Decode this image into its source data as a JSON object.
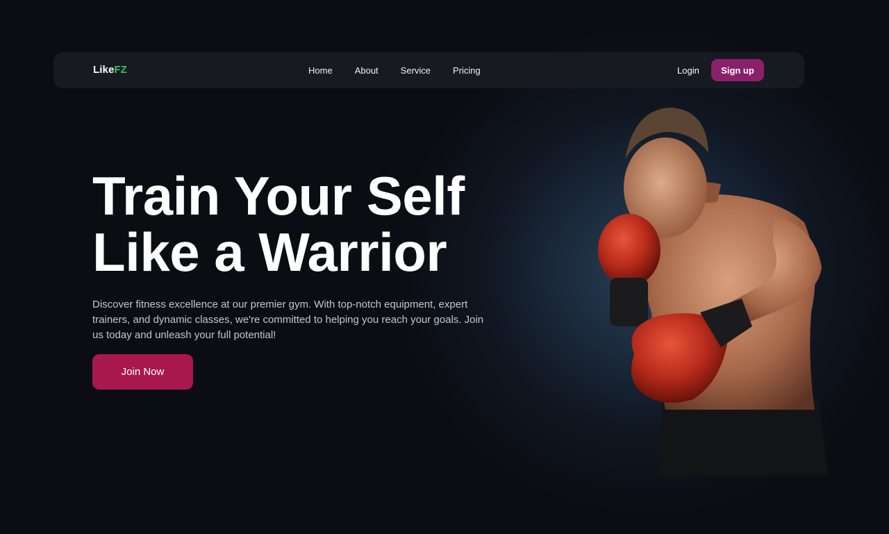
{
  "brand": {
    "logo_white": "Like",
    "logo_green": "FZ",
    "accent_green": "#3fbf5a"
  },
  "nav": {
    "links": [
      "Home",
      "About",
      "Service",
      "Pricing"
    ],
    "login_label": "Login",
    "signup_label": "Sign up",
    "signup_color": "#8c1f6a"
  },
  "hero": {
    "title_line1": "Train Your Self",
    "title_line2": "Like a Warrior",
    "description": "Discover fitness excellence at our premier gym. With top-notch equipment, expert trainers, and dynamic classes, we're committed to helping you reach your goals. Join us today and unleash your full potential!",
    "cta_label": "Join Now",
    "cta_color": "#a9184d"
  },
  "image": {
    "subject": "boxer-with-red-gloves"
  }
}
